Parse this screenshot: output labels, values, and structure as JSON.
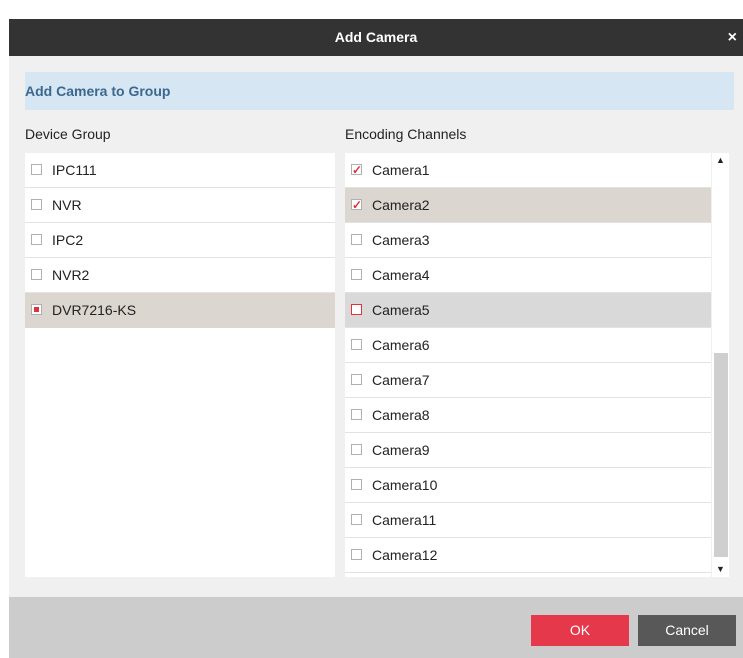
{
  "dialog": {
    "title": "Add Camera",
    "close_glyph": "×"
  },
  "banner": {
    "text": "Add Camera to Group"
  },
  "device_group": {
    "label": "Device Group",
    "items": [
      {
        "label": "IPC111",
        "checked": false
      },
      {
        "label": "NVR",
        "checked": false
      },
      {
        "label": "IPC2",
        "checked": false
      },
      {
        "label": "NVR2",
        "checked": false
      },
      {
        "label": "DVR7216-KS",
        "checked": "partial",
        "selected": true
      }
    ]
  },
  "encoding_channels": {
    "label": "Encoding Channels",
    "items": [
      {
        "label": "Camera1",
        "checked": true
      },
      {
        "label": "Camera2",
        "checked": true,
        "selected": true
      },
      {
        "label": "Camera3",
        "checked": false
      },
      {
        "label": "Camera4",
        "checked": false
      },
      {
        "label": "Camera5",
        "checked": false,
        "hover": true
      },
      {
        "label": "Camera6",
        "checked": false
      },
      {
        "label": "Camera7",
        "checked": false
      },
      {
        "label": "Camera8",
        "checked": false
      },
      {
        "label": "Camera9",
        "checked": false
      },
      {
        "label": "Camera10",
        "checked": false
      },
      {
        "label": "Camera11",
        "checked": false
      },
      {
        "label": "Camera12",
        "checked": false
      }
    ]
  },
  "scrollbar": {
    "up_glyph": "▲",
    "down_glyph": "▼"
  },
  "footer": {
    "ok_label": "OK",
    "cancel_label": "Cancel"
  },
  "colors": {
    "accent": "#e5384a",
    "titlebar": "#333333",
    "banner": "#d6e6f3"
  }
}
